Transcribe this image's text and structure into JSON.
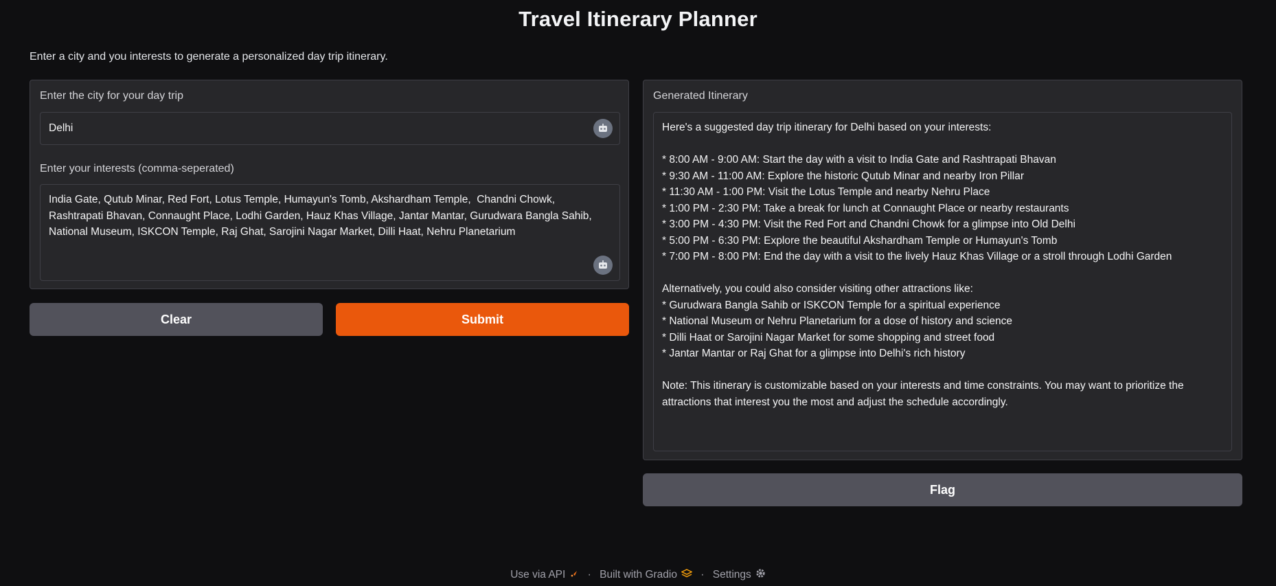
{
  "title": "Travel Itinerary Planner",
  "description": "Enter a city and you interests to generate a personalized day trip itinerary.",
  "inputs": {
    "city_label": "Enter the city for your day trip",
    "city_value": "Delhi",
    "interests_label": "Enter your interests (comma-seperated)",
    "interests_value": "India Gate, Qutub Minar, Red Fort, Lotus Temple, Humayun's Tomb, Akshardham Temple,  Chandni Chowk, Rashtrapati Bhavan, Connaught Place, Lodhi Garden, Hauz Khas Village, Jantar Mantar, Gurudwara Bangla Sahib, National Museum, ISKCON Temple, Raj Ghat, Sarojini Nagar Market, Dilli Haat, Nehru Planetarium"
  },
  "buttons": {
    "clear": "Clear",
    "submit": "Submit",
    "flag": "Flag"
  },
  "output": {
    "label": "Generated Itinerary",
    "text": "Here's a suggested day trip itinerary for Delhi based on your interests:\n\n* 8:00 AM - 9:00 AM: Start the day with a visit to India Gate and Rashtrapati Bhavan\n* 9:30 AM - 11:00 AM: Explore the historic Qutub Minar and nearby Iron Pillar\n* 11:30 AM - 1:00 PM: Visit the Lotus Temple and nearby Nehru Place\n* 1:00 PM - 2:30 PM: Take a break for lunch at Connaught Place or nearby restaurants\n* 3:00 PM - 4:30 PM: Visit the Red Fort and Chandni Chowk for a glimpse into Old Delhi\n* 5:00 PM - 6:30 PM: Explore the beautiful Akshardham Temple or Humayun's Tomb\n* 7:00 PM - 8:00 PM: End the day with a visit to the lively Hauz Khas Village or a stroll through Lodhi Garden\n\nAlternatively, you could also consider visiting other attractions like:\n* Gurudwara Bangla Sahib or ISKCON Temple for a spiritual experience\n* National Museum or Nehru Planetarium for a dose of history and science\n* Dilli Haat or Sarojini Nagar Market for some shopping and street food\n* Jantar Mantar or Raj Ghat for a glimpse into Delhi's rich history\n\nNote: This itinerary is customizable based on your interests and time constraints. You may want to prioritize the attractions that interest you the most and adjust the schedule accordingly."
  },
  "footer": {
    "api": "Use via API",
    "built": "Built with Gradio",
    "settings": "Settings",
    "separator": "·"
  },
  "icons": {
    "field_action": "robot-icon",
    "api": "rocket-icon",
    "gradio": "gradio-logo-icon",
    "settings": "gear-icon"
  },
  "colors": {
    "accent": "#ea580c",
    "secondary_button": "#52525b",
    "panel": "#27272a",
    "background": "#0f0f11"
  }
}
